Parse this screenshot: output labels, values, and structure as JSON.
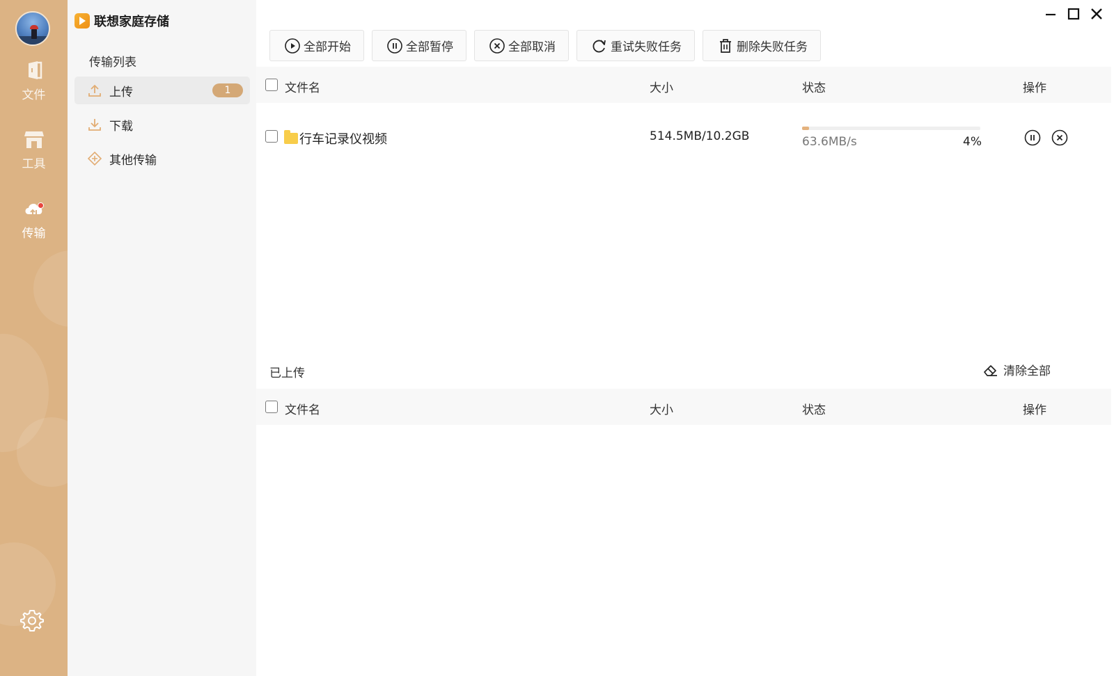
{
  "app": {
    "title": "联想家庭存储"
  },
  "rail": {
    "items": [
      {
        "label": "文件",
        "icon": "file-icon"
      },
      {
        "label": "工具",
        "icon": "store-icon"
      },
      {
        "label": "传输",
        "icon": "cloud-transfer-icon"
      }
    ],
    "settings_icon": "gear-icon"
  },
  "side": {
    "title": "传输列表",
    "items": [
      {
        "label": "上传",
        "icon": "upload-icon",
        "badge": "1"
      },
      {
        "label": "下载",
        "icon": "download-icon"
      },
      {
        "label": "其他传输",
        "icon": "other-transfer-icon"
      }
    ]
  },
  "toolbar": {
    "buttons": [
      {
        "label": "全部开始",
        "icon": "play-circle-icon"
      },
      {
        "label": "全部暂停",
        "icon": "pause-circle-icon"
      },
      {
        "label": "全部取消",
        "icon": "close-circle-icon"
      },
      {
        "label": "重试失败任务",
        "icon": "refresh-icon"
      },
      {
        "label": "删除失败任务",
        "icon": "trash-icon"
      }
    ]
  },
  "table": {
    "headers": {
      "name": "文件名",
      "size": "大小",
      "status": "状态",
      "action": "操作"
    }
  },
  "uploading": [
    {
      "name": "行车记录仪视频",
      "size": "514.5MB/10.2GB",
      "speed": "63.6MB/s",
      "percent": "4%",
      "progress": 0.04
    }
  ],
  "uploaded": {
    "title": "已上传",
    "clear_label": "清除全部"
  },
  "colors": {
    "rail": "#dcb384",
    "accent": "#d4a876",
    "progress": "#e4b27d"
  }
}
